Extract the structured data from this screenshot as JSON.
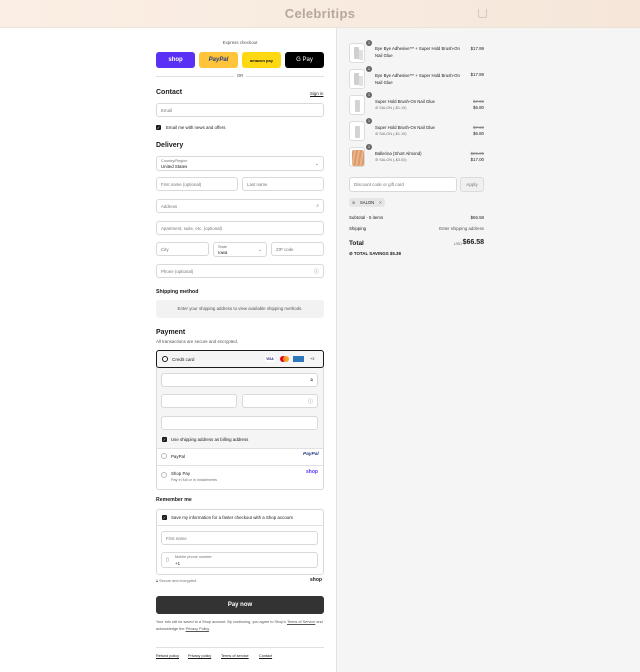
{
  "header": {
    "logo": "Celebritips"
  },
  "express": {
    "label": "Express checkout",
    "buttons": [
      {
        "label": "shop",
        "bg": "#5a31f4",
        "fg": "#ffffff"
      },
      {
        "label": "PayPal",
        "bg": "#ffc439",
        "fg": "#253b80"
      },
      {
        "label": "amazon pay",
        "bg": "#ffd814",
        "fg": "#0f1111"
      },
      {
        "label": "G Pay",
        "bg": "#000000",
        "fg": "#ffffff"
      }
    ],
    "or": "OR"
  },
  "contact": {
    "title": "Contact",
    "sign_in": "Sign in",
    "email_placeholder": "Email",
    "news_label": "Email me with news and offers"
  },
  "delivery": {
    "title": "Delivery",
    "country_label": "Country/Region",
    "country_value": "United States",
    "first_name": "First name (optional)",
    "last_name": "Last name",
    "address": "Address",
    "apartment": "Apartment, suite, etc. (optional)",
    "city": "City",
    "state_label": "State",
    "state_value": "Iowa",
    "zip": "ZIP code",
    "phone": "Phone (optional)"
  },
  "shipping": {
    "title": "Shipping method",
    "message": "Enter your shipping address to view available shipping methods."
  },
  "payment": {
    "title": "Payment",
    "subtitle": "All transactions are secure and encrypted.",
    "credit_card": "Credit card",
    "card_more": "+3",
    "billing_label": "Use shipping address as billing address",
    "paypal": "PayPal",
    "paypal_logo": "PayPal",
    "shoppay": "Shop Pay",
    "shoppay_sub": "Pay in full or in installments",
    "shoppay_logo": "shop"
  },
  "remember": {
    "title": "Remember me",
    "save_label": "Save my information for a faster checkout with a Shop account",
    "first_name": "First name",
    "mobile_label": "Mobile phone number",
    "mobile_value": "+1",
    "secure": "Secure and encrypted",
    "shop_logo": "shop"
  },
  "pay_now": "Pay now",
  "legal": {
    "prefix": "Your info will be saved to a Shop account. By continuing, you agree to Shop's",
    "terms": "Terms of Service",
    "mid": "and acknowledge the",
    "privacy": "Privacy Policy",
    "end": "."
  },
  "footer": [
    "Refund policy",
    "Privacy policy",
    "Terms of service",
    "Contact"
  ],
  "cart": {
    "items": [
      {
        "qty": "1",
        "name": "Bye Bye Adhesive™ + Super Hold Brush-On Nail Glue",
        "discount": "",
        "old_price": "",
        "price": "$17.99"
      },
      {
        "qty": "1",
        "name": "Bye Bye Adhesive™ + Super Hold Brush-On Nail Glue",
        "discount": "",
        "old_price": "",
        "price": "$17.99"
      },
      {
        "qty": "1",
        "name": "Super Hold Brush-On Nail Glue",
        "discount": "SALON (-$1.19)",
        "old_price": "$7.99",
        "price": "$6.80"
      },
      {
        "qty": "1",
        "name": "Super Hold Brush-On Nail Glue",
        "discount": "SALON (-$1.19)",
        "old_price": "$7.99",
        "price": "$6.80"
      },
      {
        "qty": "1",
        "name": "Ballerina (Short Almond)",
        "discount": "SALON (-$3.00)",
        "old_price": "$20.00",
        "price": "$17.00"
      }
    ],
    "discount_placeholder": "Discount code or gift card",
    "apply": "Apply",
    "tag": "SALON",
    "subtotal_label": "Subtotal · 5 items",
    "subtotal": "$66.58",
    "shipping_label": "Shipping",
    "shipping_value": "Enter shipping address",
    "total_label": "Total",
    "currency": "USD",
    "total": "$66.58",
    "savings": "TOTAL SAVINGS  $5.38"
  }
}
